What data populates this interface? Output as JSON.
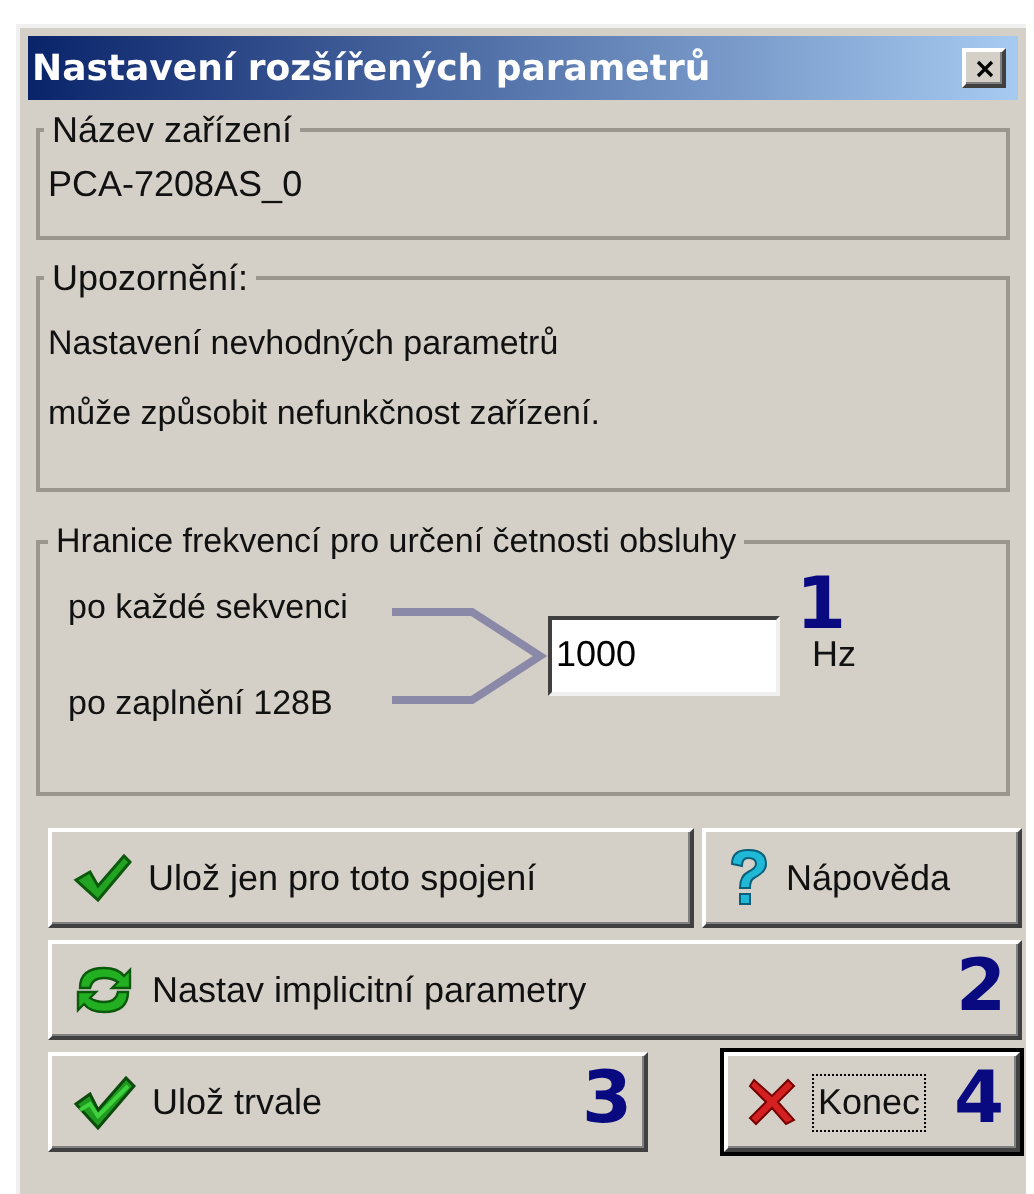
{
  "window": {
    "title": "Nastavení rozšířených parametrů"
  },
  "device_group": {
    "label": "Název zařízení",
    "value": "PCA-7208AS_0"
  },
  "warning_group": {
    "label": "Upozornění:",
    "lines": [
      "Nastavení nevhodných parametrů",
      "může způsobit nefunkčnost zařízení."
    ]
  },
  "frequency_group": {
    "label": "Hranice frekvencí pro určení četnosti obsluhy",
    "marker": "1",
    "options": [
      "po každé sekvenci",
      "po zaplnění 128B"
    ],
    "value": "1000",
    "unit": "Hz"
  },
  "button_rows": [
    {
      "buttons": [
        {
          "label": "Ulož jen pro toto spojení",
          "kind": "check",
          "focused": false
        },
        {
          "label": "Nápověda",
          "kind": "help",
          "focused": false
        }
      ]
    },
    {
      "buttons": [
        {
          "label": "Nastav implicitní parametry",
          "kind": "refresh",
          "focused": false,
          "marker": "2"
        }
      ]
    },
    {
      "buttons": [
        {
          "label": "Ulož trvale",
          "kind": "double-check",
          "focused": false,
          "marker": "3"
        },
        {
          "label": "Konec",
          "kind": "cross",
          "focused": true,
          "marker": "4"
        }
      ]
    }
  ]
}
